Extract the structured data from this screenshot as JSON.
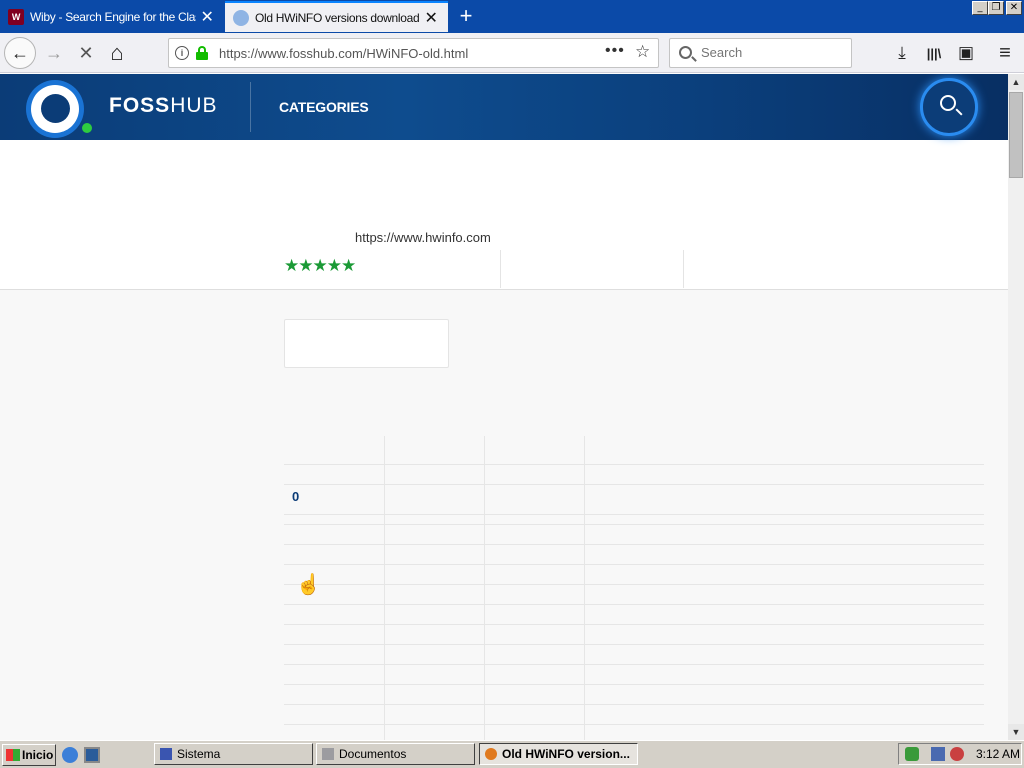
{
  "tabs": [
    {
      "label": "Wiby - Search Engine for the Classic Web",
      "favicon": "wiby-icon",
      "active": false
    },
    {
      "label": "Old HWiNFO versions download",
      "favicon": "globe-icon",
      "active": true
    }
  ],
  "favicon_wiby_text": "W",
  "close_glyph": "✕",
  "newtab_glyph": "+",
  "window_controls": [
    "_",
    "❐",
    "✕"
  ],
  "nav": {
    "back": "←",
    "forward": "→",
    "stop": "✕",
    "home": "⌂",
    "info_glyph": "i",
    "url": "https://www.fosshub.com/HWiNFO-old.html",
    "page_actions": "•••",
    "bookmark_star": "☆",
    "search_placeholder": "Search",
    "download": "⤓",
    "library": "|||\\",
    "sidebar": "▣",
    "menu": "≡"
  },
  "site": {
    "brand_bold": "FOSS",
    "brand_rest": "HUB",
    "categories": "CATEGORIES",
    "developer_url": "https://www.hwinfo.com",
    "rating": 5,
    "stars_text": "★★★★★",
    "table_first_value": "0"
  },
  "scroll": {
    "up": "▲",
    "down": "▼"
  },
  "taskbar": {
    "start_label": "Inicio",
    "buttons": [
      {
        "label": "Sistema",
        "active": false
      },
      {
        "label": "Documentos",
        "active": false
      },
      {
        "label": "Old HWiNFO version...",
        "active": true
      }
    ],
    "clock": "3:12 AM"
  },
  "colors": {
    "titlebar": "#0b4aa8",
    "site_header": "#0b3c77",
    "stars": "#1b9a36",
    "lock": "#12bc00"
  }
}
